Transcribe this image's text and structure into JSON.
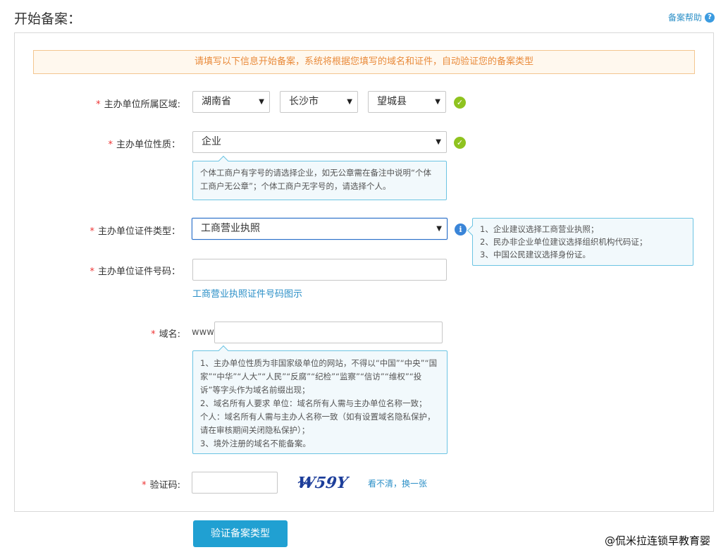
{
  "header": {
    "title": "开始备案：",
    "help_label": "备案帮助",
    "help_icon": "?"
  },
  "notice": "请填写以下信息开始备案，系统将根据您填写的域名和证件，自动验证您的备案类型",
  "form": {
    "region": {
      "label": "主办单位所属区域:",
      "province": "湖南省",
      "city": "长沙市",
      "county": "望城县"
    },
    "nature": {
      "label": "主办单位性质：",
      "value": "企业",
      "tip": "个体工商户有字号的请选择企业，如无公章需在备注中说明“个体工商户无公章”；个体工商户无字号的，请选择个人。"
    },
    "cert_type": {
      "label": "主办单位证件类型：",
      "value": "工商营业执照",
      "tips": [
        "1、企业建议选择工商营业执照；",
        "2、民办非企业单位建议选择组织机构代码证；",
        "3、中国公民建议选择身份证。"
      ]
    },
    "cert_number": {
      "label": "主办单位证件号码：",
      "value": "",
      "example_link": "工商营业执照证件号码图示"
    },
    "domain": {
      "label": "域名:",
      "prefix": "www.",
      "value": "",
      "tips": [
        "1、主办单位性质为非国家级单位的网站，不得以“中国”“中央”“国家”“中华”“人大”“人民”“反腐”“纪检”“监察”“信访”“维权”“投诉”等字头作为域名前缀出现；",
        "2、域名所有人要求 单位：域名所有人需与主办单位名称一致；",
        "个人：域名所有人需与主办人名称一致（如有设置域名隐私保护，请在审核期间关闭隐私保护）；",
        "3、境外注册的域名不能备案。"
      ]
    },
    "captcha": {
      "label": "验证码:",
      "value": "",
      "image_text": "W59Y",
      "refresh_link": "看不清，换一张"
    },
    "required_mark": "*"
  },
  "submit_label": "验证备案类型",
  "watermark": "@侃米拉连锁早教育婴",
  "colors": {
    "accent": "#20a0d2",
    "link": "#2b8fc7",
    "ok": "#8fc31f",
    "notice_text": "#e98a3a"
  }
}
